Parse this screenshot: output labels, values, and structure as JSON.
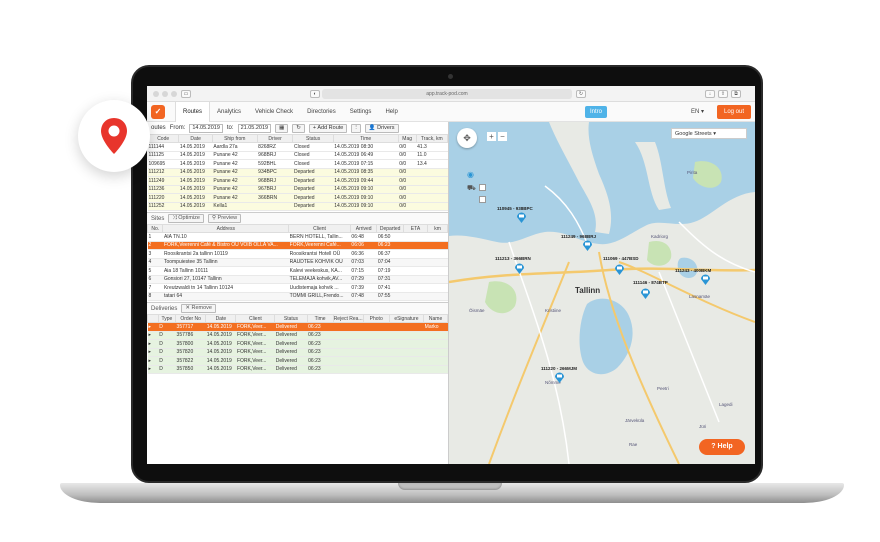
{
  "browser": {
    "url": "app.track-pod.com"
  },
  "nav": {
    "tabs": [
      {
        "label": "Routes"
      },
      {
        "label": "Analytics"
      },
      {
        "label": "Vehicle Check"
      },
      {
        "label": "Directories"
      },
      {
        "label": "Settings"
      },
      {
        "label": "Help"
      }
    ],
    "intro_label": "Intro",
    "lang_label": "EN",
    "logout_label": "Log out"
  },
  "routes": {
    "label": "outes",
    "from_label": "From:",
    "from_value": "14.05.2019",
    "to_label": "to:",
    "to_value": "21.05.2019",
    "add_route_label": "+ Add Route",
    "drivers_label": "Drivers",
    "columns": [
      "Code",
      "Date",
      "Ship from",
      "Driver",
      "Status",
      "Time",
      "Mag",
      "Track, km"
    ],
    "rows": [
      [
        "111144",
        "14.05.2019",
        "Aardla 27a",
        "8268RZ",
        "Closed",
        "14.05.2019 08:30",
        "0/0",
        "41.3"
      ],
      [
        "111125",
        "14.05.2019",
        "Punane 42",
        "968BRJ",
        "Closed",
        "14.05.2019 06:49",
        "0/0",
        "11.0"
      ],
      [
        "109695",
        "14.05.2019",
        "Punane 42",
        "592BHL",
        "Closed",
        "14.05.2019 07:15",
        "0/0",
        "13.4"
      ],
      [
        "111212",
        "14.05.2019",
        "Punane 42",
        "934BPC",
        "Departed",
        "14.05.2019 08:35",
        "0/0",
        ""
      ],
      [
        "111249",
        "14.05.2019",
        "Punane 42",
        "968BRJ",
        "Departed",
        "14.05.2019 09:44",
        "0/0",
        ""
      ],
      [
        "111236",
        "14.05.2019",
        "Punane 42",
        "967BRJ",
        "Departed",
        "14.05.2019 09:10",
        "0/0",
        ""
      ],
      [
        "111220",
        "14.05.2019",
        "Punane 42",
        "366BRN",
        "Departed",
        "14.05.2019 09:10",
        "0/0",
        ""
      ],
      [
        "111252",
        "14.05.2019",
        "Kella1",
        "",
        "Departed",
        "14.05.2019 09:10",
        "0/0",
        ""
      ]
    ]
  },
  "sites": {
    "label": "Sites",
    "optimize_label": "Optimize",
    "preview_label": "Preview",
    "columns": [
      "No.",
      "Address",
      "Client",
      "Arrived",
      "Departed",
      "ETA",
      "km"
    ],
    "rows": [
      [
        "1",
        "AIA TN.10",
        "BERN HOTELL, Tallin...",
        "06:48",
        "06:50",
        "",
        ""
      ],
      [
        "2",
        "FORK,Veerenni Café & Bistro OÜ VÕIB OLLA VA...",
        "FORK,Veerenni Café...",
        "06:06",
        "06:23",
        "",
        ""
      ],
      [
        "3",
        "Roosikrantsi 2a tallinn 10119",
        "Roosikrantsi Hotell OÜ",
        "06:36",
        "06:37",
        "",
        ""
      ],
      [
        "4",
        "Toompuiestee 35 Tallinn",
        "RAUDTEE KOHVIK OÜ",
        "07:03",
        "07:04",
        "",
        ""
      ],
      [
        "5",
        "Aia 18 Tallinn 10111",
        "Kalevi veekeskus, KA...",
        "07:15",
        "07:19",
        "",
        ""
      ],
      [
        "6",
        "Gonsiori 27, 10147 Tallinn",
        "TELEMAJA kohvik,AV...",
        "07:29",
        "07:31",
        "",
        ""
      ],
      [
        "7",
        "Kreutzwaldi tn 14 Tallinn 10124",
        "Uudistemaja kohvik ...",
        "07:39",
        "07:41",
        "",
        ""
      ],
      [
        "8",
        "tatari 64",
        "TOMMI GRILL,Frendo...",
        "07:48",
        "07:55",
        "",
        ""
      ]
    ]
  },
  "deliveries": {
    "label": "Deliveries",
    "remove_label": "Remove",
    "columns": [
      "",
      "Type",
      "Order No",
      "Date",
      "Client",
      "Status",
      "Time",
      "Reject Rea...",
      "Photo",
      "eSignature",
      "Name"
    ],
    "rows": [
      [
        "D",
        "357717",
        "14.05.2019",
        "FORK,Veer...",
        "Delivered",
        "06:23",
        "",
        "",
        "",
        "Marko"
      ],
      [
        "D",
        "357786",
        "14.05.2019",
        "FORK,Veer...",
        "Delivered",
        "06:23",
        "",
        "",
        "",
        ""
      ],
      [
        "D",
        "357800",
        "14.05.2019",
        "FORK,Veer...",
        "Delivered",
        "06:23",
        "",
        "",
        "",
        ""
      ],
      [
        "D",
        "357820",
        "14.05.2019",
        "FORK,Veer...",
        "Delivered",
        "06:23",
        "",
        "",
        "",
        ""
      ],
      [
        "D",
        "357822",
        "14.05.2019",
        "FORK,Veer...",
        "Delivered",
        "06:23",
        "",
        "",
        "",
        ""
      ],
      [
        "D",
        "357850",
        "14.05.2019",
        "FORK,Veer...",
        "Delivered",
        "06:23",
        "",
        "",
        "",
        ""
      ]
    ]
  },
  "map": {
    "layer_select": "Google Streets",
    "city_label": "Tallinn",
    "vehicles": [
      {
        "label": "110945 - 938BPC"
      },
      {
        "label": "111249 - 968BRJ"
      },
      {
        "label": "111213 - 366BRN"
      },
      {
        "label": "111069 - 447BSD"
      },
      {
        "label": "111146 - 874BTP"
      },
      {
        "label": "111243 - 400BKM"
      },
      {
        "label": "111220 - 266MJM"
      }
    ],
    "place_labels": [
      "Pirita",
      "Kadriorg",
      "Kristiine",
      "Lasnamäe",
      "Õismäe",
      "Nõmme",
      "Peetri",
      "Jüri",
      "Järveküla",
      "Rae",
      "Lagedi"
    ]
  },
  "help_label": "Help",
  "colors": {
    "brand": "#f26522",
    "selected_row": "#f36f21",
    "route_row": "#fbfbdf",
    "delivered_row": "#e6f3e0",
    "intro": "#4fb3e8",
    "vehicle": "#2a95d5"
  },
  "icons": [
    "map-pin-icon",
    "refresh-icon",
    "calendar-icon",
    "drivers-icon",
    "optimize-icon",
    "preview-icon",
    "remove-icon",
    "lock-icon",
    "signature-icon",
    "truck-icon",
    "compass-icon",
    "help-icon"
  ]
}
